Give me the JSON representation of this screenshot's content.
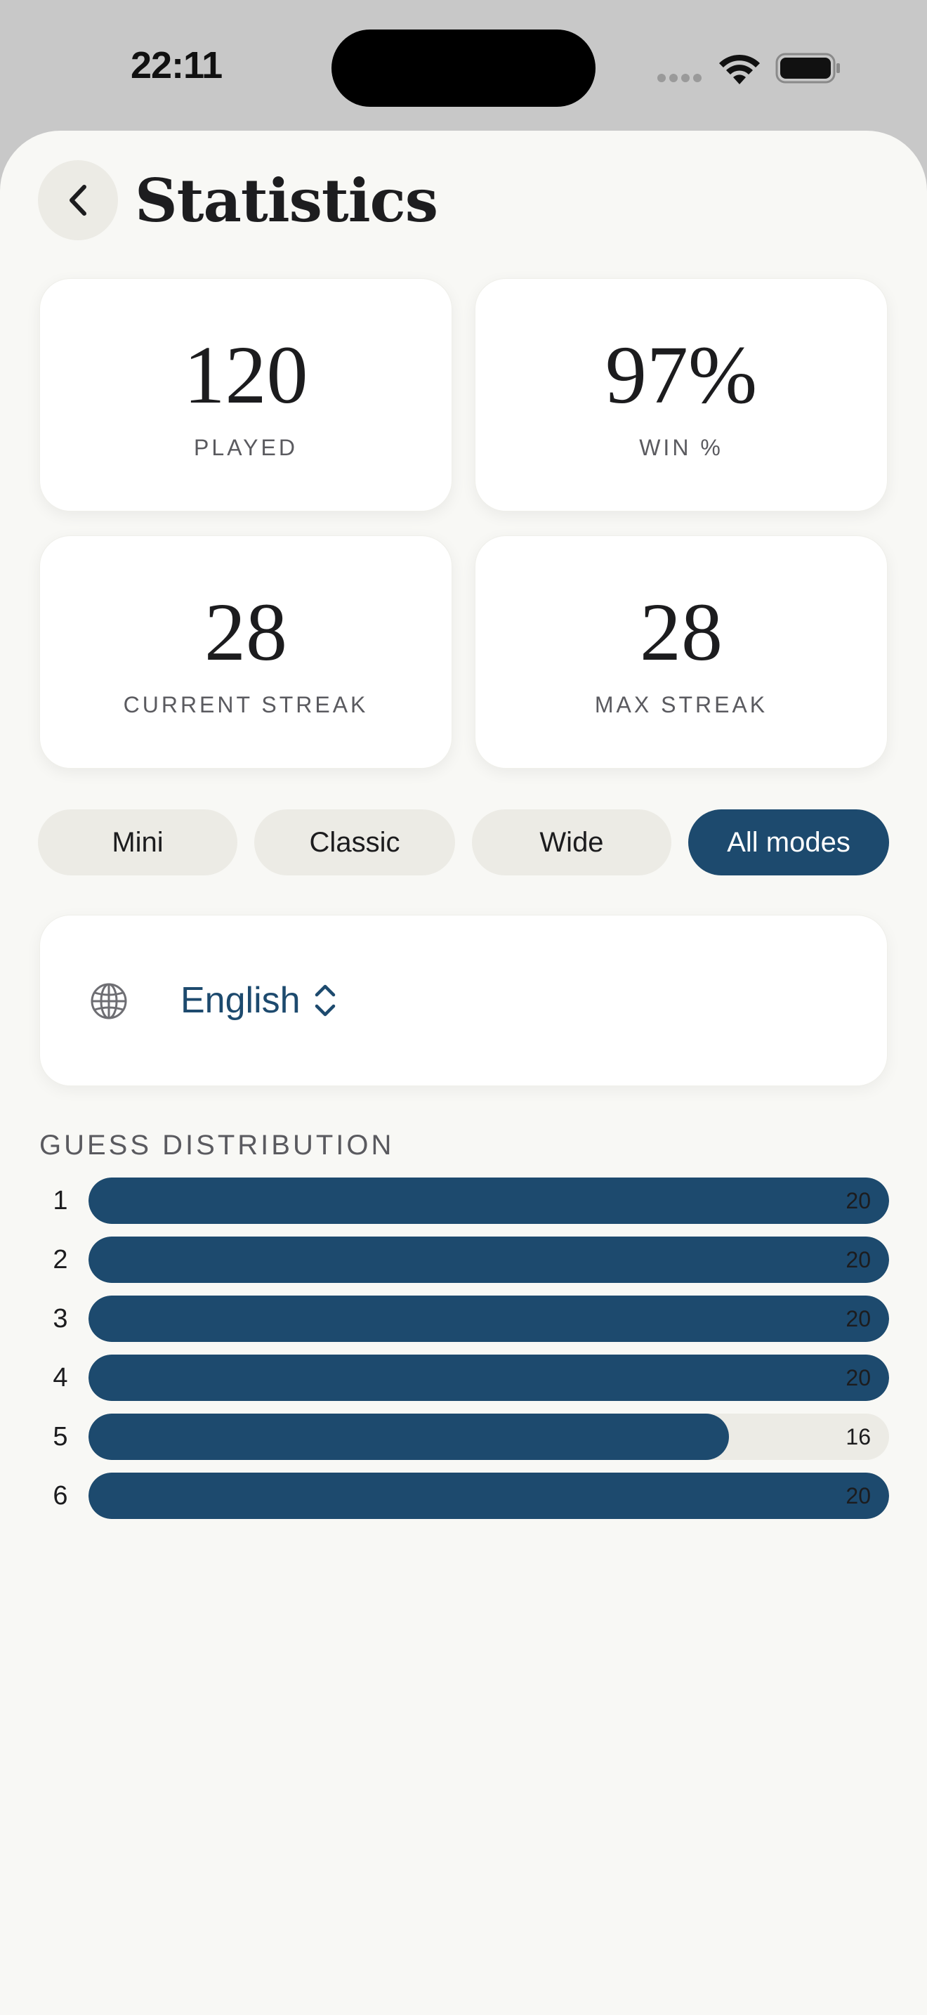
{
  "status": {
    "time": "22:11"
  },
  "header": {
    "title": "Statistics"
  },
  "stats": [
    {
      "value": "120",
      "label": "PLAYED"
    },
    {
      "value": "97%",
      "label": "WIN %"
    },
    {
      "value": "28",
      "label": "CURRENT STREAK"
    },
    {
      "value": "28",
      "label": "MAX STREAK"
    }
  ],
  "modes": [
    {
      "label": "Mini",
      "active": false
    },
    {
      "label": "Classic",
      "active": false
    },
    {
      "label": "Wide",
      "active": false
    },
    {
      "label": "All modes",
      "active": true
    }
  ],
  "language": {
    "selected": "English"
  },
  "distribution": {
    "heading": "GUESS DISTRIBUTION",
    "max": 20,
    "rows": [
      {
        "guess": "1",
        "count": 20
      },
      {
        "guess": "2",
        "count": 20
      },
      {
        "guess": "3",
        "count": 20
      },
      {
        "guess": "4",
        "count": 20
      },
      {
        "guess": "5",
        "count": 16
      },
      {
        "guess": "6",
        "count": 20
      }
    ]
  },
  "colors": {
    "accent": "#1d4a6e",
    "pill": "#ecebe5",
    "background": "#f8f8f5"
  }
}
